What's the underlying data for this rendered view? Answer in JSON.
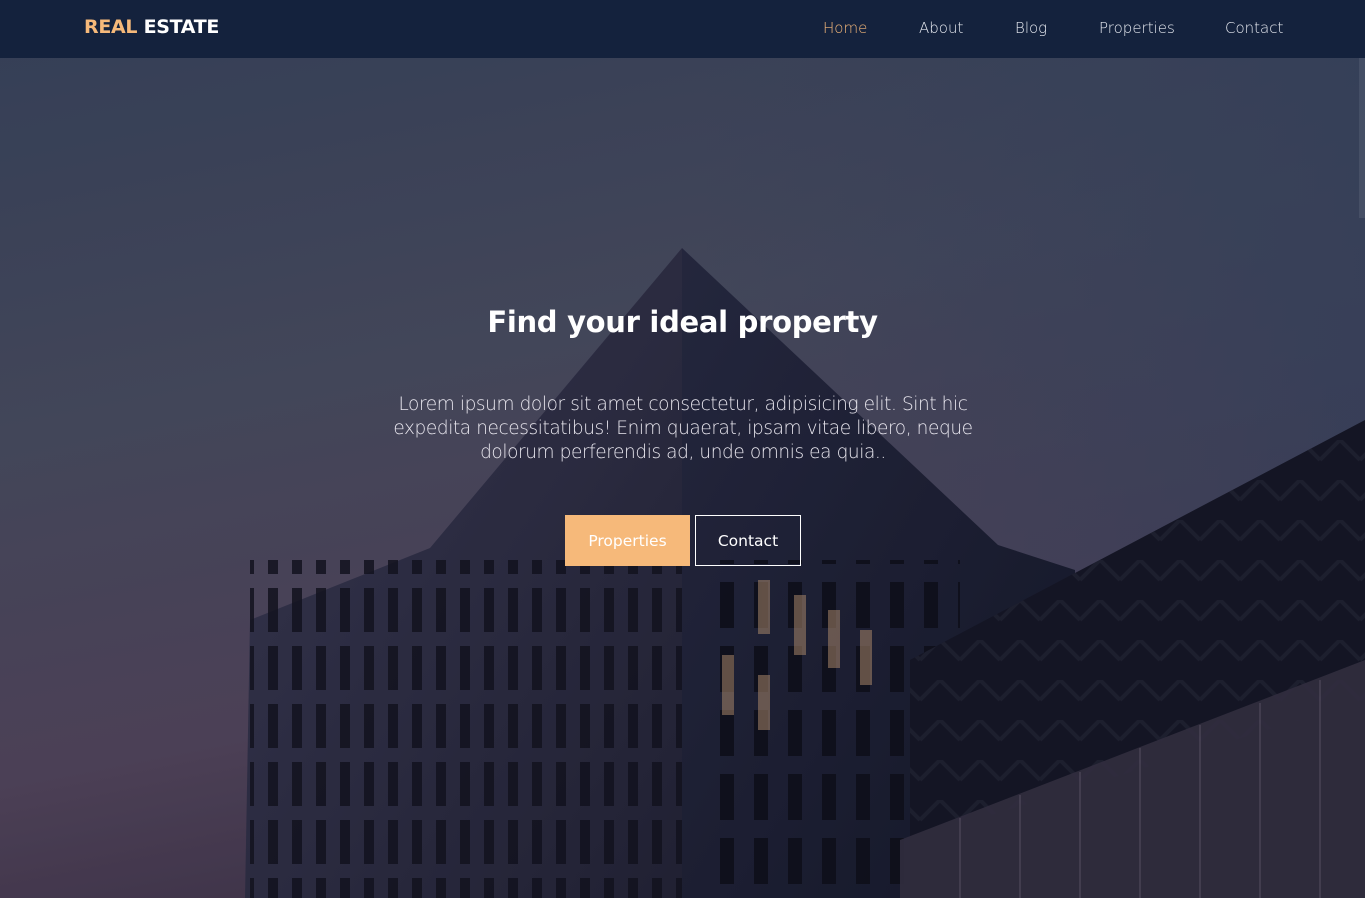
{
  "header": {
    "logo_accent": "REAL",
    "logo_rest": "ESTATE",
    "nav": [
      {
        "label": "Home",
        "active": true
      },
      {
        "label": "About",
        "active": false
      },
      {
        "label": "Blog",
        "active": false
      },
      {
        "label": "Properties",
        "active": false
      },
      {
        "label": "Contact",
        "active": false
      }
    ]
  },
  "hero": {
    "title": "Find your ideal property",
    "text": "Lorem ipsum dolor sit amet consectetur, adipisicing elit. Sint hic expedita necessitatibus! Enim quaerat, ipsam vitae libero, neque dolorum perferendis ad, unde omnis ea quia..",
    "primary_button": "Properties",
    "secondary_button": "Contact",
    "background_image": "modern-building-photo"
  },
  "colors": {
    "accent": "#f6b97a",
    "navbar": "#14223d"
  }
}
